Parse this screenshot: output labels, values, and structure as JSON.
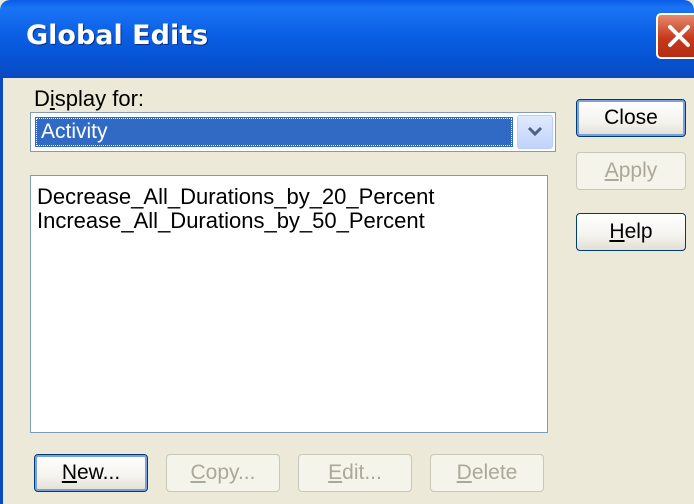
{
  "window": {
    "title": "Global Edits"
  },
  "display_for": {
    "label_prefix": "D",
    "label_underlined": "i",
    "label_suffix": "splay for:",
    "selected_value": "Activity"
  },
  "edits_list": {
    "items": [
      "Decrease_All_Durations_by_20_Percent",
      "Increase_All_Durations_by_50_Percent"
    ]
  },
  "side_buttons": {
    "close": {
      "label": "Close",
      "enabled": true
    },
    "apply": {
      "mnemonic": "A",
      "rest": "pply",
      "enabled": false
    },
    "help": {
      "mnemonic": "H",
      "rest": "elp",
      "enabled": true
    }
  },
  "bottom_buttons": {
    "new": {
      "mnemonic": "N",
      "rest": "ew...",
      "enabled": true
    },
    "copy": {
      "mnemonic": "C",
      "rest": "opy...",
      "enabled": false
    },
    "edit": {
      "mnemonic": "E",
      "rest": "dit...",
      "enabled": false
    },
    "delete": {
      "mnemonic": "D",
      "rest": "elete",
      "enabled": false
    }
  },
  "colors": {
    "title_bar": "#0a5ce6",
    "selection": "#316ac5",
    "dialog_bg": "#ece9d8",
    "close_button": "#c8381b"
  }
}
